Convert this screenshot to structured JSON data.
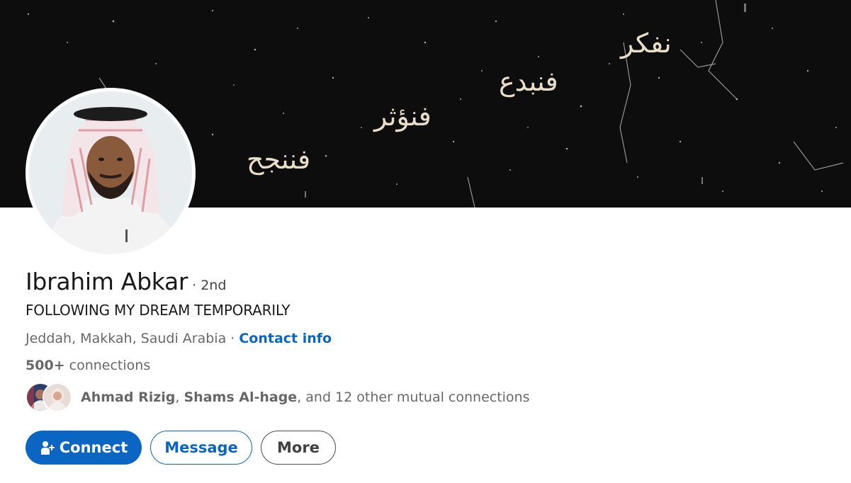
{
  "banner": {
    "words": [
      "نفكر",
      "فنبدع",
      "فنؤثر",
      "فننجح"
    ]
  },
  "profile": {
    "name": "Ibrahim Abkar",
    "degree": "· 2nd",
    "headline": "FOLLOWING MY DREAM TEMPORARILY",
    "location": "Jeddah, Makkah, Saudi Arabia",
    "separator": " · ",
    "contact_info": "Contact info",
    "connections_count": "500+",
    "connections_label": " connections"
  },
  "mutual": {
    "name1": "Ahmad Rizig",
    "comma": ", ",
    "name2": "Shams Al-hage",
    "rest": ", and 12 other mutual connections"
  },
  "actions": {
    "connect": "Connect",
    "message": "Message",
    "more": "More"
  },
  "colors": {
    "accent": "#0a66c2",
    "banner_bg": "#0d0d0d",
    "banner_text": "#e9dfc9"
  },
  "icons": [
    "add-person-icon"
  ]
}
